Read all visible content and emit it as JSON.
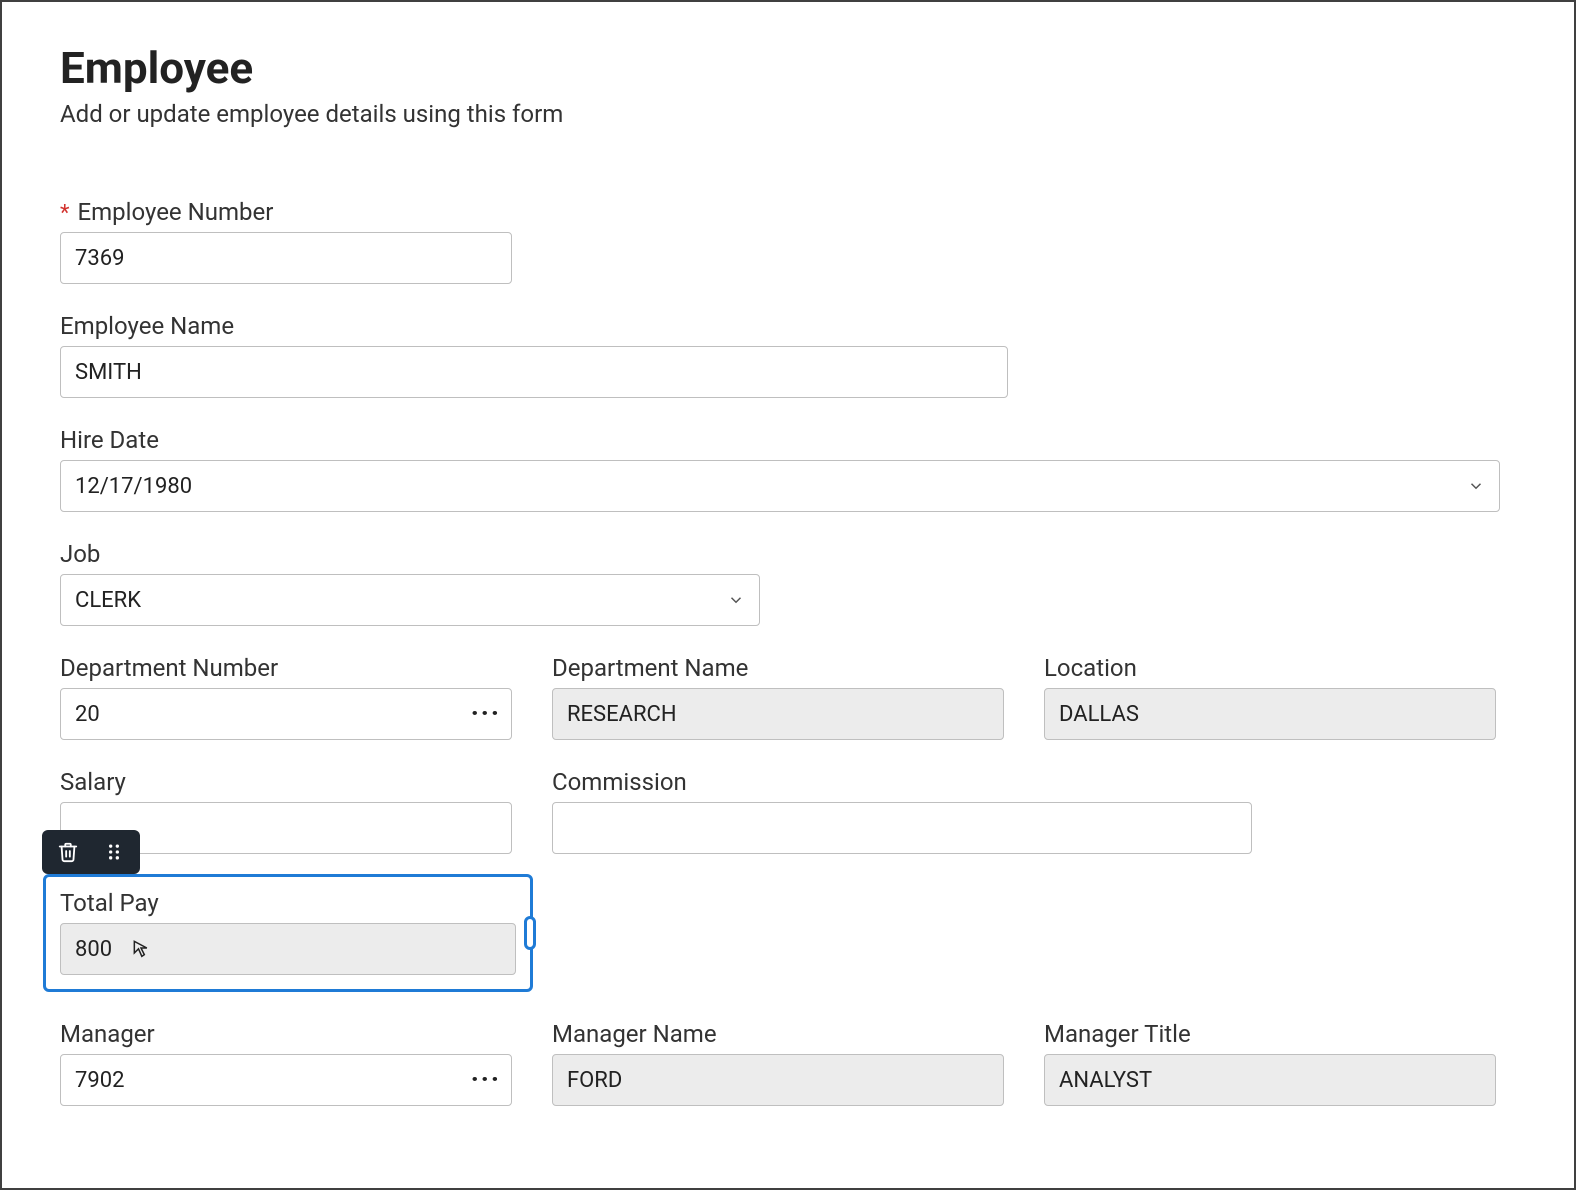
{
  "header": {
    "title": "Employee",
    "subtitle": "Add or update employee details using this form"
  },
  "form": {
    "empno": {
      "label": "Employee Number",
      "value": "7369",
      "required": true
    },
    "ename": {
      "label": "Employee Name",
      "value": "SMITH"
    },
    "hiredate": {
      "label": "Hire Date",
      "value": "12/17/1980"
    },
    "job": {
      "label": "Job",
      "value": "CLERK"
    },
    "deptno": {
      "label": "Department Number",
      "value": "20"
    },
    "dname": {
      "label": "Department Name",
      "value": "RESEARCH"
    },
    "loc": {
      "label": "Location",
      "value": "DALLAS"
    },
    "sal": {
      "label": "Salary",
      "value": ""
    },
    "comm": {
      "label": "Commission",
      "value": ""
    },
    "totalpay": {
      "label": "Total Pay",
      "value": "800"
    },
    "mgr": {
      "label": "Manager",
      "value": "7902"
    },
    "mgrname": {
      "label": "Manager Name",
      "value": "FORD"
    },
    "mgrtitle": {
      "label": "Manager Title",
      "value": "ANALYST"
    }
  }
}
